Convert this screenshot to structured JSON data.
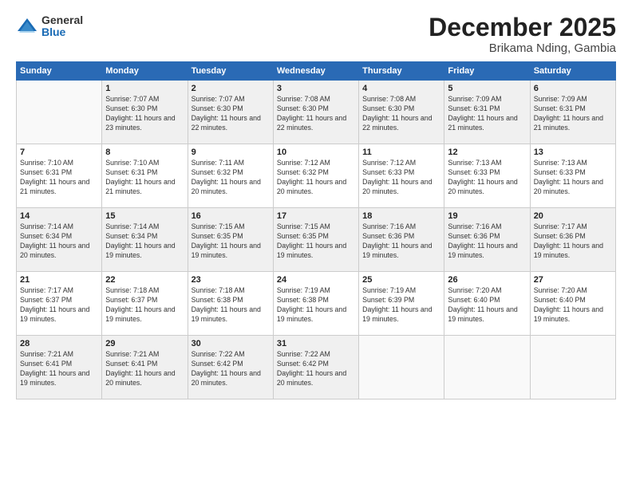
{
  "logo": {
    "general": "General",
    "blue": "Blue"
  },
  "title": {
    "month": "December 2025",
    "location": "Brikama Nding, Gambia"
  },
  "header_days": [
    "Sunday",
    "Monday",
    "Tuesday",
    "Wednesday",
    "Thursday",
    "Friday",
    "Saturday"
  ],
  "weeks": [
    [
      {
        "day": "",
        "sunrise": "",
        "sunset": "",
        "daylight": ""
      },
      {
        "day": "1",
        "sunrise": "Sunrise: 7:07 AM",
        "sunset": "Sunset: 6:30 PM",
        "daylight": "Daylight: 11 hours and 23 minutes."
      },
      {
        "day": "2",
        "sunrise": "Sunrise: 7:07 AM",
        "sunset": "Sunset: 6:30 PM",
        "daylight": "Daylight: 11 hours and 22 minutes."
      },
      {
        "day": "3",
        "sunrise": "Sunrise: 7:08 AM",
        "sunset": "Sunset: 6:30 PM",
        "daylight": "Daylight: 11 hours and 22 minutes."
      },
      {
        "day": "4",
        "sunrise": "Sunrise: 7:08 AM",
        "sunset": "Sunset: 6:30 PM",
        "daylight": "Daylight: 11 hours and 22 minutes."
      },
      {
        "day": "5",
        "sunrise": "Sunrise: 7:09 AM",
        "sunset": "Sunset: 6:31 PM",
        "daylight": "Daylight: 11 hours and 21 minutes."
      },
      {
        "day": "6",
        "sunrise": "Sunrise: 7:09 AM",
        "sunset": "Sunset: 6:31 PM",
        "daylight": "Daylight: 11 hours and 21 minutes."
      }
    ],
    [
      {
        "day": "7",
        "sunrise": "Sunrise: 7:10 AM",
        "sunset": "Sunset: 6:31 PM",
        "daylight": "Daylight: 11 hours and 21 minutes."
      },
      {
        "day": "8",
        "sunrise": "Sunrise: 7:10 AM",
        "sunset": "Sunset: 6:31 PM",
        "daylight": "Daylight: 11 hours and 21 minutes."
      },
      {
        "day": "9",
        "sunrise": "Sunrise: 7:11 AM",
        "sunset": "Sunset: 6:32 PM",
        "daylight": "Daylight: 11 hours and 20 minutes."
      },
      {
        "day": "10",
        "sunrise": "Sunrise: 7:12 AM",
        "sunset": "Sunset: 6:32 PM",
        "daylight": "Daylight: 11 hours and 20 minutes."
      },
      {
        "day": "11",
        "sunrise": "Sunrise: 7:12 AM",
        "sunset": "Sunset: 6:33 PM",
        "daylight": "Daylight: 11 hours and 20 minutes."
      },
      {
        "day": "12",
        "sunrise": "Sunrise: 7:13 AM",
        "sunset": "Sunset: 6:33 PM",
        "daylight": "Daylight: 11 hours and 20 minutes."
      },
      {
        "day": "13",
        "sunrise": "Sunrise: 7:13 AM",
        "sunset": "Sunset: 6:33 PM",
        "daylight": "Daylight: 11 hours and 20 minutes."
      }
    ],
    [
      {
        "day": "14",
        "sunrise": "Sunrise: 7:14 AM",
        "sunset": "Sunset: 6:34 PM",
        "daylight": "Daylight: 11 hours and 20 minutes."
      },
      {
        "day": "15",
        "sunrise": "Sunrise: 7:14 AM",
        "sunset": "Sunset: 6:34 PM",
        "daylight": "Daylight: 11 hours and 19 minutes."
      },
      {
        "day": "16",
        "sunrise": "Sunrise: 7:15 AM",
        "sunset": "Sunset: 6:35 PM",
        "daylight": "Daylight: 11 hours and 19 minutes."
      },
      {
        "day": "17",
        "sunrise": "Sunrise: 7:15 AM",
        "sunset": "Sunset: 6:35 PM",
        "daylight": "Daylight: 11 hours and 19 minutes."
      },
      {
        "day": "18",
        "sunrise": "Sunrise: 7:16 AM",
        "sunset": "Sunset: 6:36 PM",
        "daylight": "Daylight: 11 hours and 19 minutes."
      },
      {
        "day": "19",
        "sunrise": "Sunrise: 7:16 AM",
        "sunset": "Sunset: 6:36 PM",
        "daylight": "Daylight: 11 hours and 19 minutes."
      },
      {
        "day": "20",
        "sunrise": "Sunrise: 7:17 AM",
        "sunset": "Sunset: 6:36 PM",
        "daylight": "Daylight: 11 hours and 19 minutes."
      }
    ],
    [
      {
        "day": "21",
        "sunrise": "Sunrise: 7:17 AM",
        "sunset": "Sunset: 6:37 PM",
        "daylight": "Daylight: 11 hours and 19 minutes."
      },
      {
        "day": "22",
        "sunrise": "Sunrise: 7:18 AM",
        "sunset": "Sunset: 6:37 PM",
        "daylight": "Daylight: 11 hours and 19 minutes."
      },
      {
        "day": "23",
        "sunrise": "Sunrise: 7:18 AM",
        "sunset": "Sunset: 6:38 PM",
        "daylight": "Daylight: 11 hours and 19 minutes."
      },
      {
        "day": "24",
        "sunrise": "Sunrise: 7:19 AM",
        "sunset": "Sunset: 6:38 PM",
        "daylight": "Daylight: 11 hours and 19 minutes."
      },
      {
        "day": "25",
        "sunrise": "Sunrise: 7:19 AM",
        "sunset": "Sunset: 6:39 PM",
        "daylight": "Daylight: 11 hours and 19 minutes."
      },
      {
        "day": "26",
        "sunrise": "Sunrise: 7:20 AM",
        "sunset": "Sunset: 6:40 PM",
        "daylight": "Daylight: 11 hours and 19 minutes."
      },
      {
        "day": "27",
        "sunrise": "Sunrise: 7:20 AM",
        "sunset": "Sunset: 6:40 PM",
        "daylight": "Daylight: 11 hours and 19 minutes."
      }
    ],
    [
      {
        "day": "28",
        "sunrise": "Sunrise: 7:21 AM",
        "sunset": "Sunset: 6:41 PM",
        "daylight": "Daylight: 11 hours and 19 minutes."
      },
      {
        "day": "29",
        "sunrise": "Sunrise: 7:21 AM",
        "sunset": "Sunset: 6:41 PM",
        "daylight": "Daylight: 11 hours and 20 minutes."
      },
      {
        "day": "30",
        "sunrise": "Sunrise: 7:22 AM",
        "sunset": "Sunset: 6:42 PM",
        "daylight": "Daylight: 11 hours and 20 minutes."
      },
      {
        "day": "31",
        "sunrise": "Sunrise: 7:22 AM",
        "sunset": "Sunset: 6:42 PM",
        "daylight": "Daylight: 11 hours and 20 minutes."
      },
      {
        "day": "",
        "sunrise": "",
        "sunset": "",
        "daylight": ""
      },
      {
        "day": "",
        "sunrise": "",
        "sunset": "",
        "daylight": ""
      },
      {
        "day": "",
        "sunrise": "",
        "sunset": "",
        "daylight": ""
      }
    ]
  ]
}
